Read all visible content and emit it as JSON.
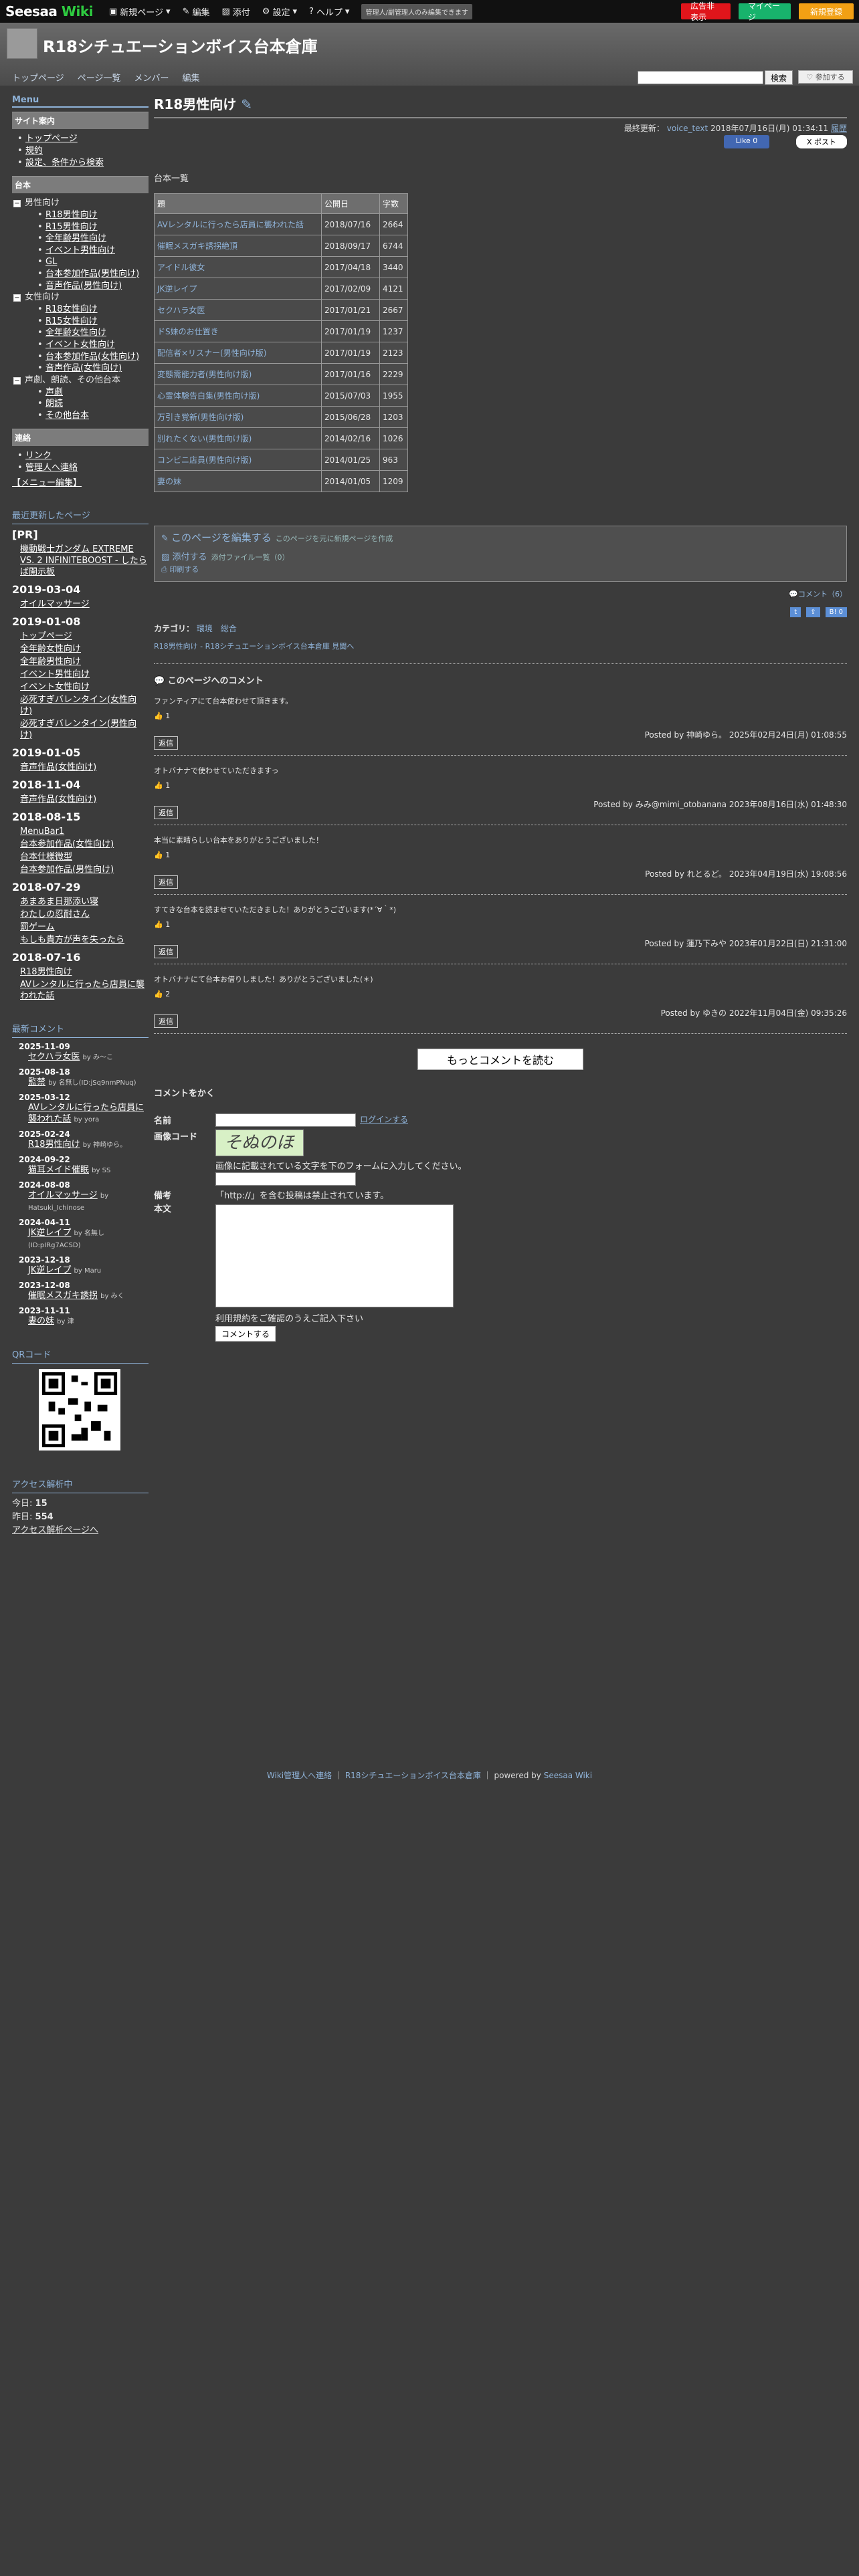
{
  "topbar": {
    "logo": "Seesaa",
    "logo_suffix": "Wiki",
    "items": [
      "新規ページ",
      "編集",
      "添付",
      "設定",
      "ヘルプ"
    ],
    "note": "管理人/副管理人のみ編集できます",
    "ad_btn": "広告非表示",
    "mypage_btn": "マイページ",
    "signup_btn": "新規登録"
  },
  "header": {
    "title": "R18シチュエーションボイス台本倉庫",
    "nav": [
      "トップページ",
      "ページ一覧",
      "メンバー",
      "編集"
    ],
    "search_btn": "検索",
    "join_btn": "♡ 参加する"
  },
  "sidebar": {
    "menu_title": "Menu",
    "guide_title": "サイト案内",
    "guide_items": [
      "トップページ",
      "規約",
      "設定、条件から検索"
    ],
    "script_title": "台本",
    "male_group": "男性向け",
    "male_items": [
      "R18男性向け",
      "R15男性向け",
      "全年齢男性向け",
      "イベント男性向け",
      "GL",
      "台本参加作品(男性向け)",
      "音声作品(男性向け)"
    ],
    "female_group": "女性向け",
    "female_items": [
      "R18女性向け",
      "R15女性向け",
      "全年齢女性向け",
      "イベント女性向け",
      "台本参加作品(女性向け)",
      "音声作品(女性向け)"
    ],
    "other_group": "声劇、朗読、その他台本",
    "other_items": [
      "声劇",
      "朗読",
      "その他台本"
    ],
    "contact_title": "連絡",
    "contact_items": [
      "リンク",
      "管理人へ連絡"
    ],
    "menu_edit": "【メニュー編集】",
    "recent_title": "最近更新したページ",
    "pr_label": "[PR]",
    "pr_link": "機動戦士ガンダム EXTREME VS. 2 INFINITEBOOST - したらば開示板",
    "updates": [
      {
        "date": "2019-03-04",
        "items": [
          "オイルマッサージ"
        ]
      },
      {
        "date": "2019-01-08",
        "items": [
          "トップページ",
          "全年齢女性向け",
          "全年齢男性向け",
          "イベント男性向け",
          "イベント女性向け",
          "必死すぎバレンタイン(女性向け)",
          "必死すぎバレンタイン(男性向け)"
        ]
      },
      {
        "date": "2019-01-05",
        "items": [
          "音声作品(女性向け)"
        ]
      },
      {
        "date": "2018-11-04",
        "items": [
          "音声作品(女性向け)"
        ]
      },
      {
        "date": "2018-08-15",
        "items": [
          "MenuBar1",
          "台本参加作品(女性向け)",
          "台本仕様微型",
          "台本参加作品(男性向け)"
        ]
      },
      {
        "date": "2018-07-29",
        "items": [
          "あまあま日那添い寝",
          "わたしの忍耐さん",
          "罰ゲーム",
          "もしも貴方が声を失ったら"
        ]
      },
      {
        "date": "2018-07-16",
        "items": [
          "R18男性向け",
          "AVレンタルに行ったら店員に襲われた話"
        ]
      }
    ],
    "rc_title": "最新コメント",
    "recent_comments": [
      {
        "date": "2025-11-09",
        "page": "セクハラ女医",
        "by": "by み～こ"
      },
      {
        "date": "2025-08-18",
        "page": "監禁",
        "by": "by 名無し(ID:jSq9nmPNuq)"
      },
      {
        "date": "2025-03-12",
        "page": "AVレンタルに行ったら店員に襲われた話",
        "by": "by yora"
      },
      {
        "date": "2025-02-24",
        "page": "R18男性向け",
        "by": "by 神崎ゆら。"
      },
      {
        "date": "2024-09-22",
        "page": "猫耳メイド催眠",
        "by": "by SS"
      },
      {
        "date": "2024-08-08",
        "page": "オイルマッサージ",
        "by": "by Hatsuki_Ichinose"
      },
      {
        "date": "2024-04-11",
        "page": "JK逆レイプ",
        "by": "by 名無し(ID:pIRg7ACSD)"
      },
      {
        "date": "2023-12-18",
        "page": "JK逆レイプ",
        "by": "by Maru"
      },
      {
        "date": "2023-12-08",
        "page": "催眠メスガキ誘拐",
        "by": "by みく"
      },
      {
        "date": "2023-11-11",
        "page": "妻の妹",
        "by": "by 津"
      }
    ],
    "qr_title": "QRコード",
    "access_title": "アクセス解析中",
    "today_label": "今日:",
    "today_value": "15",
    "yesterday_label": "昨日:",
    "yesterday_value": "554",
    "access_link": "アクセス解析ページへ"
  },
  "main": {
    "title": "R18男性向け",
    "meta": "最終更新：",
    "meta_user": "voice_text",
    "meta_date": "2018年07月16日(月) 01:34:11",
    "meta_hist": "履歴",
    "fb_like": "Like 0",
    "x_post": "X ポスト",
    "list_label": "台本一覧",
    "table_headers": [
      "題",
      "公開日",
      "字数"
    ],
    "rows": [
      [
        "AVレンタルに行ったら店員に襲われた話",
        "2018/07/16",
        "2664"
      ],
      [
        "催眠メスガキ誘拐絶頂",
        "2018/09/17",
        "6744"
      ],
      [
        "アイドル彼女",
        "2017/04/18",
        "3440"
      ],
      [
        "JK逆レイプ",
        "2017/02/09",
        "4121"
      ],
      [
        "セクハラ女医",
        "2017/01/21",
        "2667"
      ],
      [
        "ドS妹のお仕置き",
        "2017/01/19",
        "1237"
      ],
      [
        "配信者×リスナー(男性向け版)",
        "2017/01/19",
        "2123"
      ],
      [
        "変態需能力者(男性向け版)",
        "2017/01/16",
        "2229"
      ],
      [
        "心霊体験告白集(男性向け版)",
        "2015/07/03",
        "1955"
      ],
      [
        "万引き覚新(男性向け版)",
        "2015/06/28",
        "1203"
      ],
      [
        "別れたくない(男性向け版)",
        "2014/02/16",
        "1026"
      ],
      [
        "コンビニ店員(男性向け版)",
        "2014/01/25",
        "963"
      ],
      [
        "妻の妹",
        "2014/01/05",
        "1209"
      ]
    ],
    "edit_big": "このページを編集する",
    "edit_small": "このページを元に新規ページを作成",
    "attach": "添付する",
    "attach_small": "添付ファイル一覧（0）",
    "print": "印刷する",
    "comment_link": "コメント（6）",
    "category_label": "カテゴリ：",
    "category_values": "環境　総合",
    "crumb": "R18男性向け - R18シチュエーションボイス台本倉庫 見聞へ",
    "comments_title": "このページへのコメント",
    "comments": [
      {
        "body": "ファンティアにて台本使わせて頂きます。",
        "likes": "1",
        "by": "Posted by 神崎ゆら。 2025年02月24日(月) 01:08:55"
      },
      {
        "body": "オトバナナで使わせていただきますっ",
        "likes": "1",
        "by": "Posted by みみ@mimi_otobanana 2023年08月16日(水) 01:48:30"
      },
      {
        "body": "本当に素晴らしい台本をありがとうございました！",
        "likes": "1",
        "by": "Posted by れとるど。 2023年04月19日(水) 19:08:56"
      },
      {
        "body": "すてきな台本を読ませていただきました！ありがとうございます(*´∀｀*)",
        "likes": "1",
        "by": "Posted by 蓮乃下みや 2023年01月22日(日) 21:31:00"
      },
      {
        "body": "オトバナナにて台本お借りしました！ありがとうございました(＊)",
        "likes": "2",
        "by": "Posted by ゆきの 2022年11月04日(金) 09:35:26"
      }
    ],
    "reply_label": "返信",
    "more_btn": "もっとコメントを読む",
    "form_title": "コメントをかく",
    "name_label": "名前",
    "login_link": "ログインする",
    "captcha_label": "画像コード",
    "captcha_text": "そぬのほ",
    "captcha_help": "画像に記載されている文字を下のフォームに入力してください。",
    "remarks_label": "備考",
    "body_label": "本文",
    "http_note": "「http://」を含む投稿は禁止されています。",
    "terms_text": "利用規約をご確認のうえご記入下さい",
    "submit_btn": "コメントする"
  },
  "footer": {
    "contact": "Wiki管理人へ連絡",
    "site": "R18シチュエーションボイス台本倉庫",
    "powered": "powered by",
    "powered_link": "Seesaa Wiki"
  }
}
